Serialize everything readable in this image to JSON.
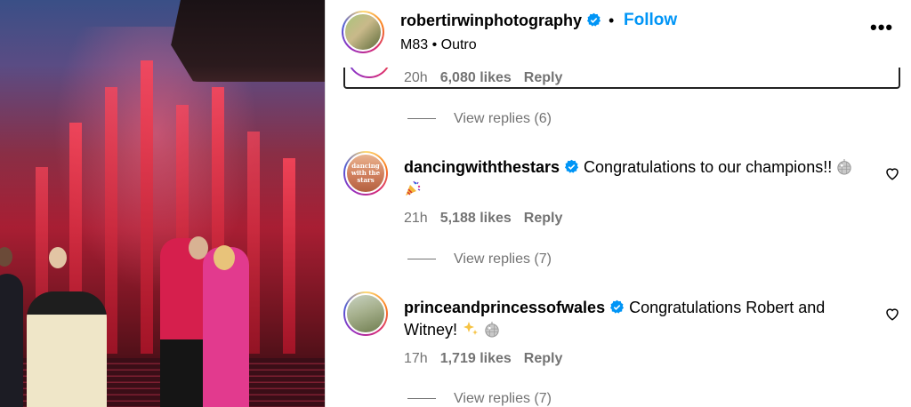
{
  "header": {
    "username": "robertirwinphotography",
    "separator": "•",
    "follow_label": "Follow",
    "audio": "M83 • Outro",
    "more_icon": "more-horizontal-icon"
  },
  "previous_comment": {
    "time": "20h",
    "likes": "6,080 likes",
    "reply_label": "Reply"
  },
  "replies_1": {
    "label": "View replies (6)"
  },
  "comment_1": {
    "username": "dancingwiththestars",
    "avatar_text": "dancing with the stars",
    "text": "Congratulations to our champions!!",
    "emoji": [
      "mirror-ball",
      "party-popper"
    ],
    "time": "21h",
    "likes": "5,188 likes",
    "reply_label": "Reply"
  },
  "replies_2": {
    "label": "View replies (7)"
  },
  "comment_2": {
    "username": "princeandprincessofwales",
    "text_line1": "Congratulations Robert and",
    "text_line2": "Witney!",
    "emoji": [
      "sparkles",
      "mirror-ball"
    ],
    "time": "17h",
    "likes": "1,719 likes",
    "reply_label": "Reply"
  },
  "replies_3": {
    "label": "View replies (7)"
  },
  "colors": {
    "link_blue": "#0095f6",
    "verified_blue": "#0095f6",
    "muted": "#737373"
  }
}
